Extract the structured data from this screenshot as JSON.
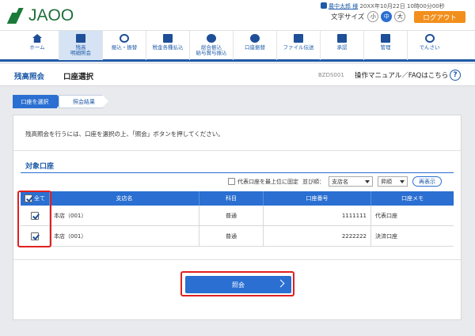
{
  "header": {
    "logo_text": "JAOO",
    "user_name": "農中太郎 様",
    "last_login": "20XX年10月22日 10時00分00秒",
    "font_size_label": "文字サイズ",
    "font_sizes": [
      "小",
      "中",
      "大"
    ],
    "active_font_size": "中",
    "logout_label": "ログアウト"
  },
  "nav": {
    "items": [
      {
        "label": "ホーム",
        "icon": "home-icon"
      },
      {
        "label": "残高\n明細照会",
        "icon": "balance-icon",
        "active": true
      },
      {
        "label": "振込・振替",
        "icon": "transfer-icon"
      },
      {
        "label": "税金各種払込",
        "icon": "tax-payment-icon"
      },
      {
        "label": "総合振込\n給与賞与振込",
        "icon": "bulk-transfer-icon"
      },
      {
        "label": "口座振替",
        "icon": "account-transfer-icon"
      },
      {
        "label": "ファイル伝送",
        "icon": "file-transfer-icon"
      },
      {
        "label": "承認",
        "icon": "approval-icon"
      },
      {
        "label": "管理",
        "icon": "admin-icon"
      },
      {
        "label": "でんさい",
        "icon": "densai-icon"
      }
    ]
  },
  "page": {
    "title_main": "残高照会",
    "title_sub": "口座選択",
    "screen_id": "BZDS001",
    "help_link": "操作マニュアル／FAQはこちら",
    "help_icon": "?"
  },
  "steps": [
    "口座を選択",
    "照会結果"
  ],
  "panel": {
    "instruction": "残高照会を行うには、口座を選択の上、「照会」ボタンを押してください。",
    "section_title": "対象口座",
    "pin_label": "代表口座を最上位に固定",
    "sort_label": "並び順：",
    "sort_key": "支店名",
    "sort_order": "昇順",
    "redisplay_label": "再表示",
    "table": {
      "headers": [
        "全て",
        "支店名",
        "科目",
        "口座番号",
        "口座メモ"
      ],
      "rows": [
        {
          "branch": "本店（001）",
          "type": "普通",
          "number": "1111111",
          "memo": "代表口座",
          "checked": true
        },
        {
          "branch": "本店（001）",
          "type": "普通",
          "number": "2222222",
          "memo": "決済口座",
          "checked": true
        }
      ]
    },
    "inquiry_label": "照会"
  },
  "colors": {
    "brand_green": "#1e6f3a",
    "primary_blue": "#2a6fd1",
    "logout_orange": "#f28f1c",
    "highlight_red": "#e02020"
  }
}
